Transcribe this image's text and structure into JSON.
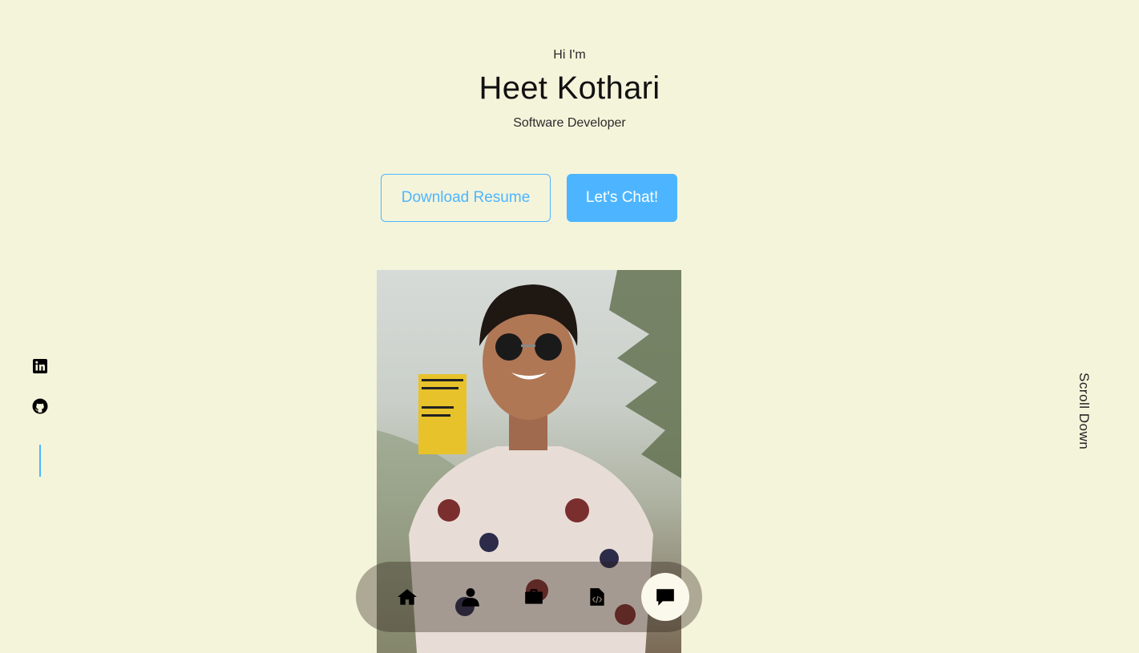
{
  "hero": {
    "greeting": "Hi I'm",
    "name": "Heet Kothari",
    "role": "Software Developer"
  },
  "actions": {
    "download_label": "Download Resume",
    "chat_label": "Let's Chat!"
  },
  "side": {
    "scroll_label": "Scroll Down",
    "socials": [
      "linkedin-icon",
      "github-icon"
    ]
  },
  "nav": {
    "items": [
      "home-icon",
      "user-icon",
      "briefcase-icon",
      "code-file-icon",
      "chat-icon"
    ],
    "active": "chat-icon"
  },
  "colors": {
    "background": "#f4f4db",
    "accent": "#4db5ff"
  }
}
